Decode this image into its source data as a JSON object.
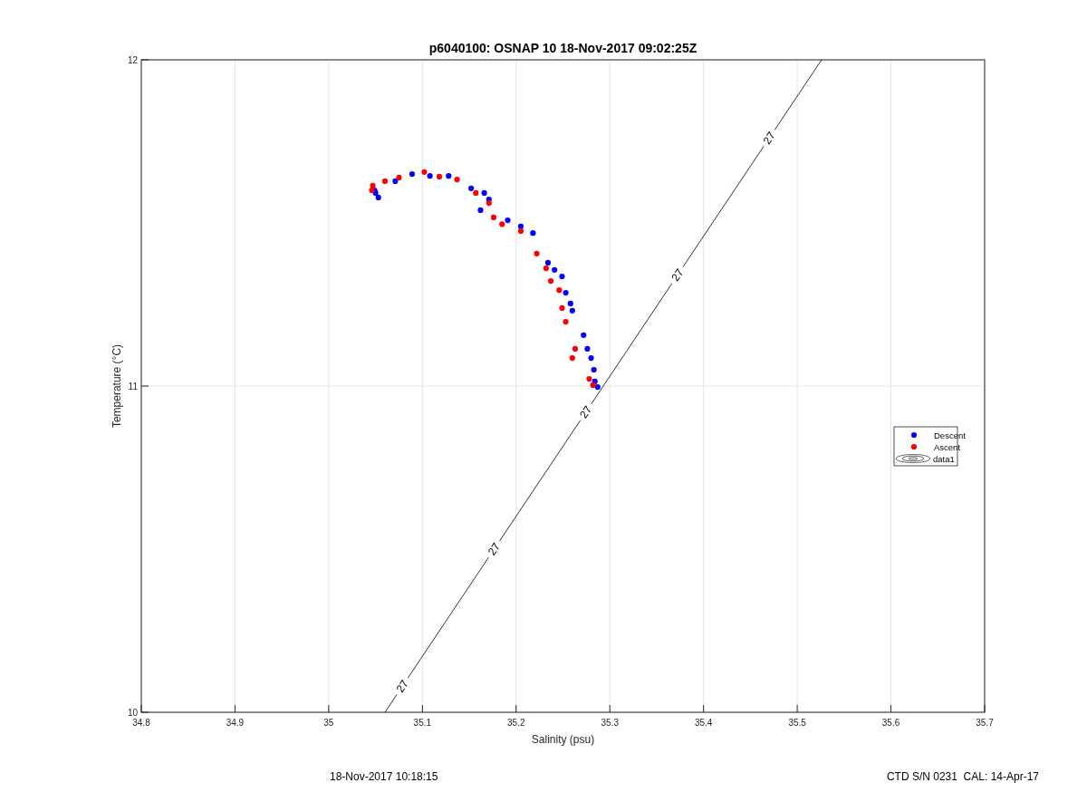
{
  "figure": {
    "chart_data": {
      "type": "scatter",
      "title": "p6040100: OSNAP 10 18-Nov-2017 09:02:25Z",
      "xlabel": "Salinity (psu)",
      "ylabel": "Temperature (°C)",
      "xlim": [
        34.8,
        35.7
      ],
      "legend": "right",
      "ylim": [
        10,
        12
      ],
      "grid": true,
      "xticks": [
        {
          "value": 34.8,
          "label": "34.8"
        },
        {
          "value": 34.9,
          "label": "34.9"
        },
        {
          "value": 35,
          "label": "35"
        },
        {
          "value": 35.1,
          "label": "35.1"
        },
        {
          "value": 35.2,
          "label": "35.2"
        },
        {
          "value": 35.3,
          "label": "35.3"
        },
        {
          "value": 35.4,
          "label": "35.4"
        },
        {
          "value": 35.5,
          "label": "35.5"
        },
        {
          "value": 35.6,
          "label": "35.6"
        },
        {
          "value": 35.7,
          "label": "35.7"
        }
      ],
      "yticks": [
        {
          "value": 10,
          "label": "10"
        },
        {
          "value": 11,
          "label": "11"
        },
        {
          "value": 12,
          "label": "12"
        }
      ],
      "series": [
        {
          "name": "Descent",
          "color": "#0000ff",
          "x": [
            35.05,
            35.053,
            35.049,
            35.071,
            35.089,
            35.108,
            35.128,
            35.152,
            35.166,
            35.171,
            35.162,
            35.191,
            35.205,
            35.218,
            35.234,
            35.241,
            35.249,
            35.253,
            35.258,
            35.26,
            35.272,
            35.276,
            35.28,
            35.283,
            35.287,
            35.284
          ],
          "values": [
            11.592,
            11.578,
            11.6,
            11.628,
            11.65,
            11.644,
            11.644,
            11.606,
            11.592,
            11.572,
            11.539,
            11.508,
            11.489,
            11.469,
            11.378,
            11.356,
            11.336,
            11.286,
            11.253,
            11.231,
            11.156,
            11.114,
            11.086,
            11.05,
            10.997,
            11.014
          ]
        },
        {
          "name": "Ascent",
          "color": "#ff0000",
          "x": [
            35.046,
            35.047,
            35.06,
            35.075,
            35.102,
            35.118,
            35.137,
            35.157,
            35.171,
            35.176,
            35.185,
            35.205,
            35.222,
            35.232,
            35.237,
            35.246,
            35.249,
            35.253,
            35.263,
            35.26,
            35.278,
            35.282
          ],
          "values": [
            11.6,
            11.614,
            11.628,
            11.639,
            11.656,
            11.642,
            11.633,
            11.592,
            11.561,
            11.517,
            11.496,
            11.475,
            11.406,
            11.361,
            11.322,
            11.294,
            11.239,
            11.197,
            11.114,
            11.086,
            11.022,
            11.003
          ]
        },
        {
          "name": "data1",
          "type": "line",
          "color": "#000000",
          "x": [
            35.06,
            35.526
          ],
          "values": [
            10,
            12
          ]
        }
      ],
      "annotations": [
        "27",
        "27",
        "27",
        "27",
        "27"
      ]
    }
  },
  "footer": {
    "left": "18-Nov-2017 10:18:15",
    "right": "CTD S/N 0231  CAL: 14-Apr-17"
  }
}
